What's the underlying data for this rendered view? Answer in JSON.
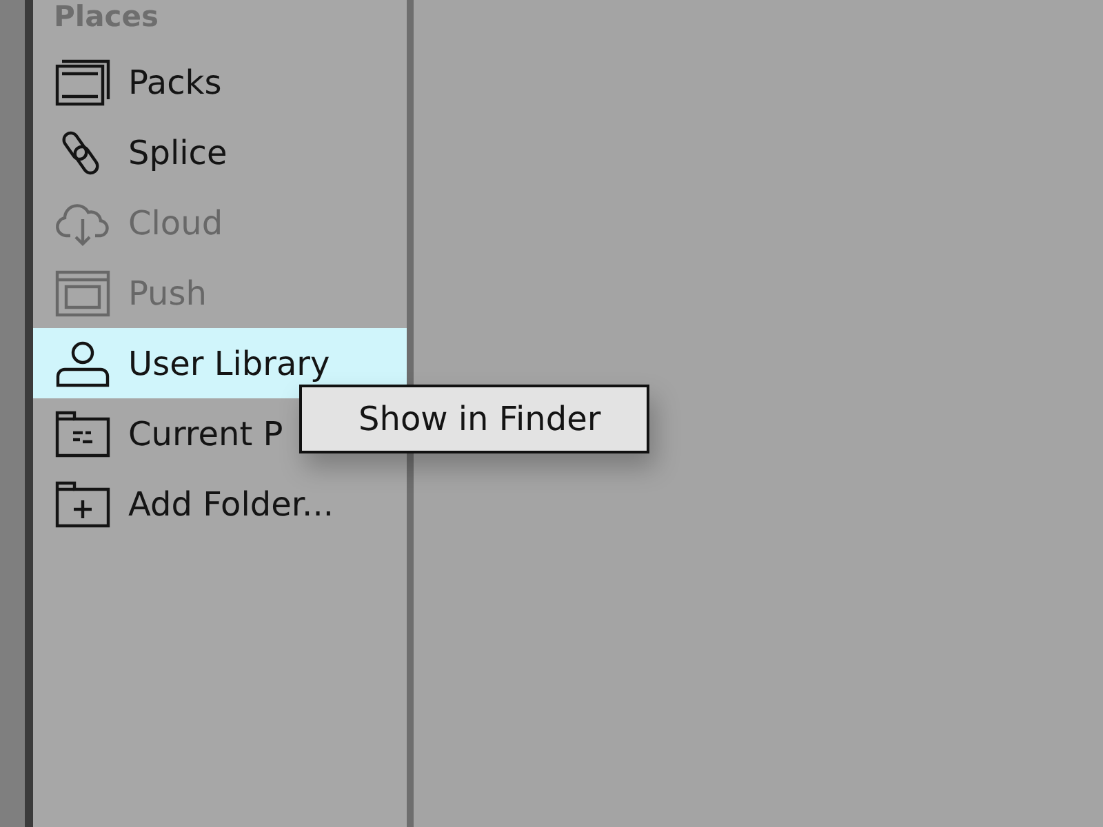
{
  "sidebar": {
    "heading": "Places",
    "items": [
      {
        "label": "Packs",
        "selected": false,
        "disabled": false
      },
      {
        "label": "Splice",
        "selected": false,
        "disabled": false
      },
      {
        "label": "Cloud",
        "selected": false,
        "disabled": true
      },
      {
        "label": "Push",
        "selected": false,
        "disabled": true
      },
      {
        "label": "User Library",
        "selected": true,
        "disabled": false
      },
      {
        "label": "Current P",
        "selected": false,
        "disabled": false
      },
      {
        "label": "Add Folder...",
        "selected": false,
        "disabled": false
      }
    ]
  },
  "context_menu": {
    "items": [
      {
        "label": "Show in Finder"
      }
    ]
  }
}
